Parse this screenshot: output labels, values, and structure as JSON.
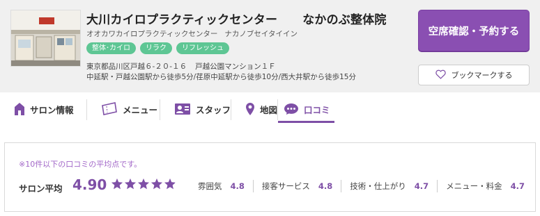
{
  "salon": {
    "name_main": "大川カイロプラクティックセンター",
    "name_sub": "なかのぶ整体院",
    "kana_main": "オオカワカイロプラクティックセンター",
    "kana_sub": "ナカノブセイタイイン",
    "tags": [
      "整体･カイロ",
      "リラク",
      "リフレッシュ"
    ],
    "address_main": "東京都品川区戸越６-２０-１６",
    "address_building": "戸越公園マンション１Ｆ",
    "access": "中延駅・戸越公園駅から徒歩5分/荏原中延駅から徒歩10分/西大井駅から徒歩15分"
  },
  "actions": {
    "reserve_label": "空席確認・予約する",
    "bookmark_label": "ブックマークする"
  },
  "tabs": [
    {
      "label": "サロン情報",
      "icon": "home-icon"
    },
    {
      "label": "メニュー",
      "icon": "ticket-icon"
    },
    {
      "label": "スタッフ",
      "icon": "staff-card-icon"
    },
    {
      "label": "地図",
      "icon": "map-pin-icon"
    },
    {
      "label": "口コミ",
      "icon": "speech-bubble-icon",
      "active": true
    }
  ],
  "reviews": {
    "note": "※10件以下の口コミの平均点です。",
    "avg_label": "サロン平均",
    "avg_value": "4.90",
    "avg_rating": 4.9,
    "star_color": "#7e4fa6",
    "categories": [
      {
        "label": "雰囲気",
        "value": "4.8"
      },
      {
        "label": "接客サービス",
        "value": "4.8"
      },
      {
        "label": "技術・仕上がり",
        "value": "4.7"
      },
      {
        "label": "メニュー・料金",
        "value": "4.7"
      }
    ]
  },
  "colors": {
    "accent": "#7e4fa6",
    "reserve_button": "#8a4fb2",
    "tag": "#5ec694",
    "note": "#a267c8"
  }
}
